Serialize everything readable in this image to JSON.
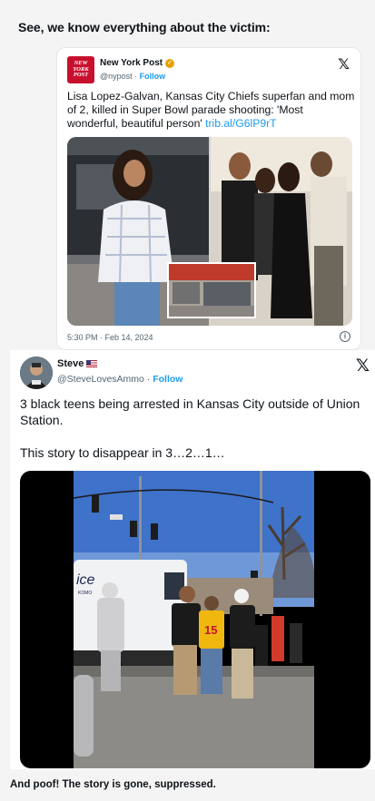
{
  "captions": {
    "top": "See, we know everything about the victim:",
    "bottom": "And poof! The story is gone, suppressed."
  },
  "tweet1": {
    "logo_lines": [
      "NEW",
      "YORK",
      "POST"
    ],
    "name": "New York Post",
    "handle": "@nypost",
    "follow_label": "Follow",
    "text": "Lisa Lopez-Galvan, Kansas City Chiefs superfan and mom of 2, killed in Super Bowl parade shooting: 'Most wonderful, beautiful person' ",
    "link": "trib.al/G6lP9rT",
    "date": "5:30 PM · Feb 14, 2024",
    "info_glyph": "i",
    "x_glyph": "𝕏"
  },
  "tweet2": {
    "name": "Steve",
    "handle": "@SteveLovesAmmo",
    "separator": "·",
    "follow_label": "Follow",
    "text": "3 black teens being arrested in Kansas City outside of Union Station.\n\nThis story to disappear in 3…2…1…",
    "x_glyph": "𝕏",
    "video_sign_text": "ice",
    "video_truck_text": "KOMO",
    "video_jersey_number": "15"
  },
  "colors": {
    "link_blue": "#1d9bf0",
    "nyp_red": "#c8102e",
    "verified_gold": "#e5a100",
    "text_dark": "#0f1419",
    "text_gray": "#536471"
  },
  "icons": {
    "close": "x-logo-icon",
    "verified": "verified-badge-icon",
    "flag": "us-flag-icon",
    "info": "info-icon"
  }
}
